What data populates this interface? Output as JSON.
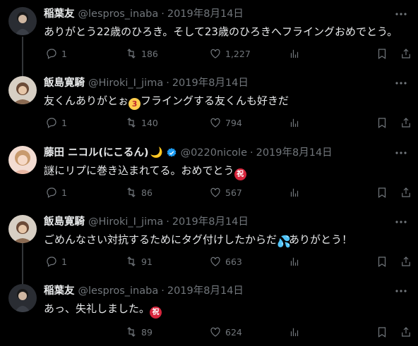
{
  "tweets": [
    {
      "name": "稲葉友",
      "handle": "@lespros_inaba",
      "dot": "·",
      "date": "2019年8月14日",
      "text": "ありがとう22歳のひろき。そして23歳のひろきへフライングおめでとう。",
      "replies": "1",
      "retweets": "186",
      "likes": "1,227"
    },
    {
      "name": "飯島寛騎",
      "handle": "@Hiroki_I_jima",
      "dot": "·",
      "date": "2019年8月14日",
      "text_a": "友くんありがとぉ",
      "text_b": "フライングする友くんも好きだ",
      "replies": "1",
      "retweets": "140",
      "likes": "794"
    },
    {
      "name": "藤田 ニコル(にこるん)",
      "moon": "🌙",
      "handle": "@0220nicole",
      "dot": "·",
      "date": "2019年8月14日",
      "text": "謎にリプに巻き込まれてる。おめでとう",
      "replies": "1",
      "retweets": "86",
      "likes": "567"
    },
    {
      "name": "飯島寛騎",
      "handle": "@Hiroki_I_jima",
      "dot": "·",
      "date": "2019年8月14日",
      "text_a": "ごめんなさい対抗するためにタグ付けしたからだ",
      "text_b": "ありがとう！",
      "replies": "1",
      "retweets": "91",
      "likes": "663"
    },
    {
      "name": "稲葉友",
      "handle": "@lespros_inaba",
      "dot": "·",
      "date": "2019年8月14日",
      "text": "あっ、失礼しました。",
      "retweets": "89",
      "likes": "624"
    }
  ],
  "emoji": {
    "iwai": "祝",
    "kiss": "3",
    "sweat": "💦"
  },
  "icons": {
    "more": "more-icon",
    "reply": "reply-icon",
    "retweet": "retweet-icon",
    "like": "heart-icon",
    "views": "views-icon",
    "bookmark": "bookmark-icon",
    "share": "share-icon"
  },
  "colors": {
    "background": "#000000",
    "text": "#e7e9ea",
    "muted": "#71767b",
    "verified": "#1d9bf0",
    "thread_line": "#333639"
  }
}
